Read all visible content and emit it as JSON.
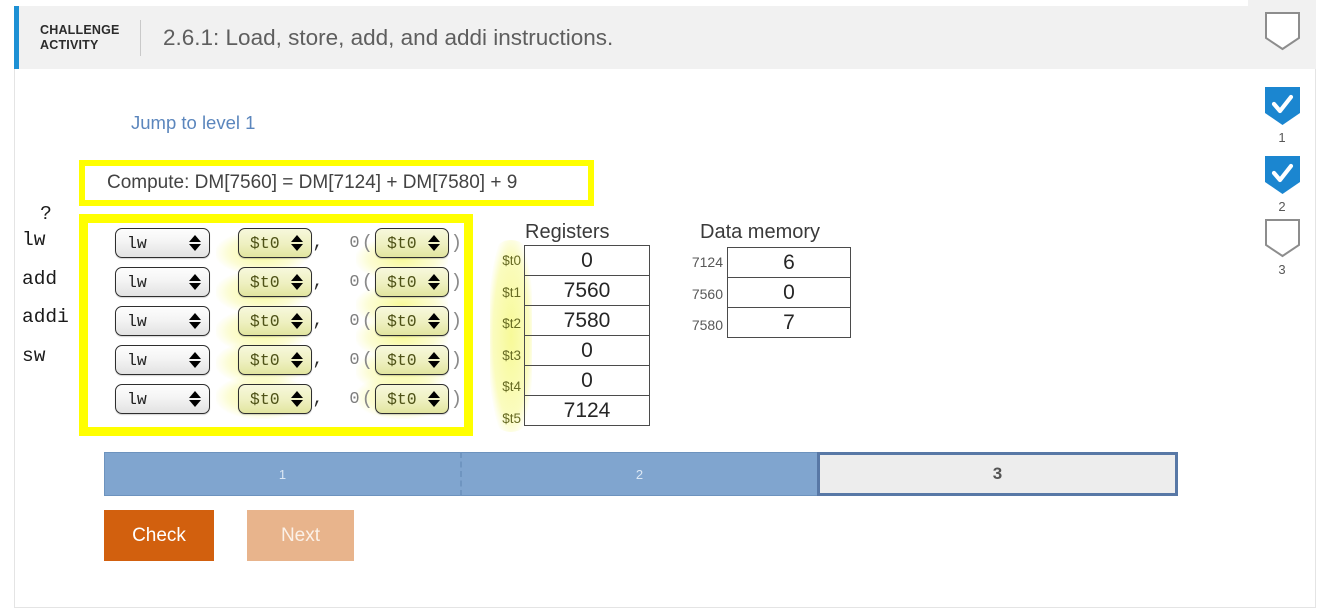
{
  "header": {
    "kicker_line1": "CHALLENGE",
    "kicker_line2": "ACTIVITY",
    "title": "2.6.1: Load, store, add, and addi instructions.",
    "accent_color": "#1d90d4"
  },
  "rail": {
    "badges": [
      {
        "state": "empty",
        "number": ""
      },
      {
        "state": "checked",
        "number": "1"
      },
      {
        "state": "checked",
        "number": "2"
      },
      {
        "state": "empty",
        "number": "3"
      }
    ],
    "checked_color": "#1b86d0"
  },
  "content": {
    "jump_link": "Jump to level 1",
    "compute_text": "Compute: DM[7560] = DM[7124] + DM[7580] + 9",
    "highlight_color": "#ffff00"
  },
  "mnemonics": [
    "?",
    "lw",
    "add",
    "addi",
    "sw"
  ],
  "instructions": {
    "rows": [
      {
        "op": "lw",
        "rd": "$t0",
        "offset": "0",
        "rs": "$t0"
      },
      {
        "op": "lw",
        "rd": "$t0",
        "offset": "0",
        "rs": "$t0"
      },
      {
        "op": "lw",
        "rd": "$t0",
        "offset": "0",
        "rs": "$t0"
      },
      {
        "op": "lw",
        "rd": "$t0",
        "offset": "0",
        "rs": "$t0"
      },
      {
        "op": "lw",
        "rd": "$t0",
        "offset": "0",
        "rs": "$t0"
      }
    ],
    "comma": ",",
    "paren_open": "(",
    "paren_close": ")"
  },
  "registers": {
    "title": "Registers",
    "labels": [
      "$t0",
      "$t1",
      "$t2",
      "$t3",
      "$t4",
      "$t5"
    ],
    "values": [
      "0",
      "7560",
      "7580",
      "0",
      "0",
      "7124"
    ]
  },
  "data_memory": {
    "title": "Data memory",
    "addresses": [
      "7124",
      "7560",
      "7580"
    ],
    "values": [
      "6",
      "0",
      "7"
    ]
  },
  "progress": {
    "segments": [
      {
        "label": "1",
        "state": "done"
      },
      {
        "label": "2",
        "state": "done"
      },
      {
        "label": "3",
        "state": "current"
      }
    ],
    "done_color": "#80a5cf",
    "current_color": "#ededed",
    "current_border": "#5878a6"
  },
  "buttons": {
    "check": "Check",
    "next": "Next",
    "check_color": "#d2600e",
    "next_color": "#e8b48c"
  }
}
